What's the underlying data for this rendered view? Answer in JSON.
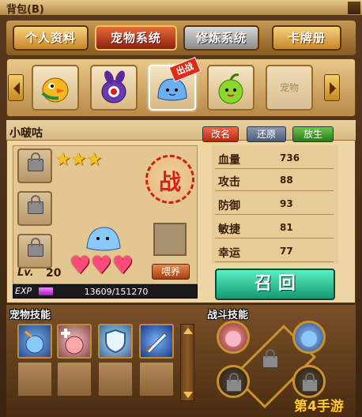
{
  "window": {
    "title": "背包(B)"
  },
  "tabs": [
    {
      "label": "个人资料",
      "style": "gold"
    },
    {
      "label": "宠物系统",
      "style": "red"
    },
    {
      "label": "修炼系统",
      "style": "gray"
    },
    {
      "label": "卡牌册",
      "style": "gold"
    }
  ],
  "pet_row": {
    "slots": [
      {
        "icon": "yellow-bird-pet-icon"
      },
      {
        "icon": "purple-eye-pet-icon"
      },
      {
        "icon": "blue-slime-pet-icon",
        "badge": "出战"
      },
      {
        "icon": "green-apple-pet-icon"
      },
      {
        "label": "宠物"
      }
    ]
  },
  "pet": {
    "name": "小啵咕",
    "battle_seal": "战",
    "stars": 3,
    "hearts": 3,
    "level_label": "Lv.",
    "level": "20",
    "exp_label": "EXP",
    "exp_text": "13609/151270",
    "exp_fraction": 0.09,
    "feed_label": "喂养"
  },
  "actions": {
    "rename": "改名",
    "restore": "还原",
    "release": "放生"
  },
  "stats": [
    {
      "label": "血量",
      "value": "736"
    },
    {
      "label": "攻击",
      "value": "88"
    },
    {
      "label": "防御",
      "value": "93"
    },
    {
      "label": "敏捷",
      "value": "81"
    },
    {
      "label": "幸运",
      "value": "77"
    }
  ],
  "summon_label": "召 回",
  "pet_skills_header": "宠物技能",
  "battle_skills_header": "战斗技能",
  "watermark": "第4手游",
  "colors": {
    "accent": "#2fb08a",
    "exp": "#c83ad8"
  }
}
